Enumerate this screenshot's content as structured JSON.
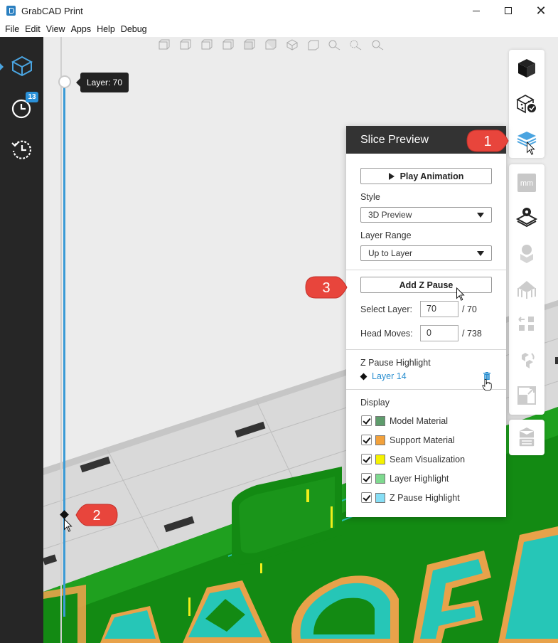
{
  "window": {
    "title": "GrabCAD Print"
  },
  "menu": [
    "File",
    "Edit",
    "View",
    "Apps",
    "Help",
    "Debug"
  ],
  "left_nav": {
    "items": [
      {
        "name": "prepare-icon"
      },
      {
        "name": "print-queue-icon",
        "badge": "13"
      },
      {
        "name": "history-icon"
      }
    ]
  },
  "layer_slider": {
    "tooltip": "Layer: 70",
    "current_layer": 70,
    "total_layers": 70,
    "pause_layer": 14
  },
  "callouts": [
    "1",
    "2",
    "3"
  ],
  "slice_preview": {
    "title": "Slice Preview",
    "play_button": "Play Animation",
    "style_label": "Style",
    "style_value": "3D Preview",
    "layer_range_label": "Layer Range",
    "layer_range_value": "Up to Layer",
    "add_z_pause_button": "Add Z Pause",
    "select_layer_label": "Select Layer:",
    "select_layer_value": "70",
    "select_layer_total": "/ 70",
    "head_moves_label": "Head Moves:",
    "head_moves_value": "0",
    "head_moves_total": "/ 738",
    "z_pause_highlight_label": "Z Pause Highlight",
    "z_pause_item": "Layer 14",
    "display_label": "Display",
    "display_items": [
      {
        "label": "Model Material",
        "color": "#5e9c6c",
        "checked": true
      },
      {
        "label": "Support Material",
        "color": "#f2a13b",
        "checked": true
      },
      {
        "label": "Seam Visualization",
        "color": "#f5f200",
        "checked": true
      },
      {
        "label": "Layer Highlight",
        "color": "#7ed98f",
        "checked": true
      },
      {
        "label": "Z Pause Highlight",
        "color": "#86def5",
        "checked": true
      }
    ]
  },
  "right_tools": {
    "unit_label": "mm"
  },
  "colors": {
    "accent": "#3b9bd6",
    "callout": "#e8453c",
    "model_green": "#138a13",
    "support_orange": "#e8a24a",
    "teal": "#26c6b7"
  }
}
